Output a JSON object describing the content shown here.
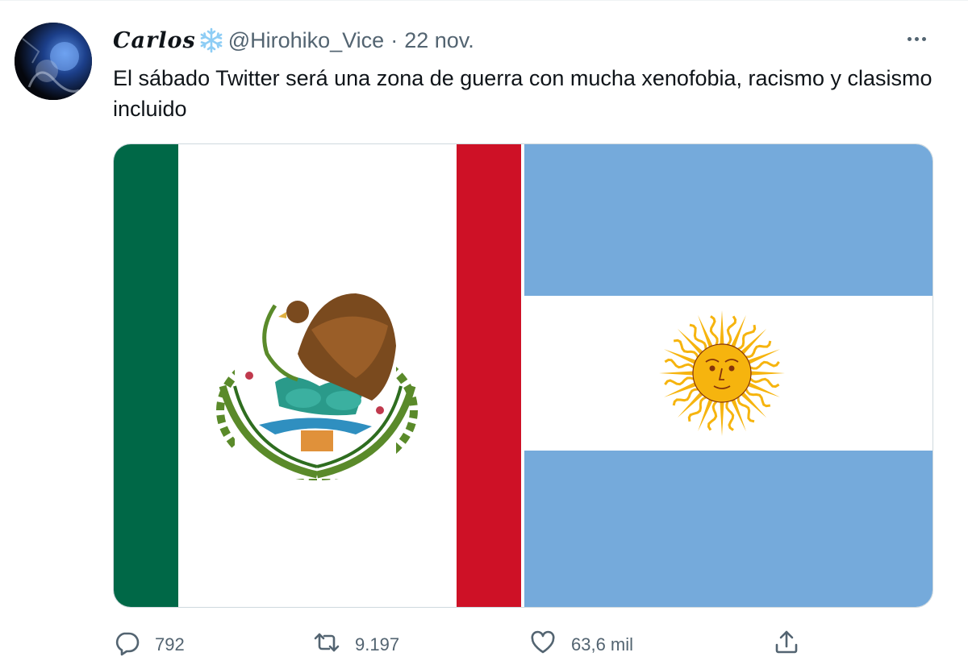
{
  "tweet": {
    "display_name": "Carlos",
    "name_emoji": "snowflake-icon",
    "handle": "@Hirohiko_Vice",
    "separator": "·",
    "date": "22 nov.",
    "text": "El sábado Twitter será una zona de guerra con mucha xenofobia, racismo y clasismo incluido",
    "media": {
      "left_image": "flag-of-mexico",
      "right_image": "flag-of-argentina"
    },
    "actions": {
      "replies": "792",
      "retweets": "9.197",
      "likes": "63,6 mil"
    }
  },
  "colors": {
    "text_primary": "#0f1419",
    "text_secondary": "#536471",
    "snowflake": "#8ecdf5",
    "mexico_green": "#006847",
    "mexico_red": "#ce1126",
    "argentina_blue": "#75aadb",
    "sun_gold": "#f6b40e"
  }
}
